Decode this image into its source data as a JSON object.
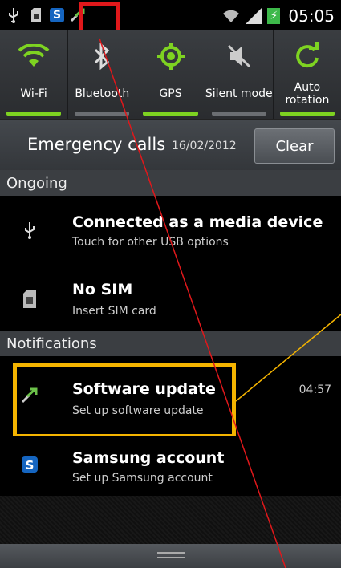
{
  "status_bar": {
    "time": "05:05",
    "icons": [
      "usb-icon",
      "sd-card-icon",
      "samsung-s-icon",
      "software-update-icon",
      "wifi-signal-icon",
      "cell-signal-icon",
      "battery-charging-icon"
    ],
    "samsung_letter": "S"
  },
  "toggles": [
    {
      "label": "Wi-Fi",
      "icon": "wifi-icon",
      "on": true
    },
    {
      "label": "Bluetooth",
      "icon": "bluetooth-icon",
      "on": false
    },
    {
      "label": "GPS",
      "icon": "gps-icon",
      "on": true
    },
    {
      "label": "Silent mode",
      "icon": "silent-mode-icon",
      "on": false
    },
    {
      "label": "Auto rotation",
      "icon": "rotation-icon",
      "on": true
    }
  ],
  "emergency": {
    "text": "Emergency calls",
    "date": "16/02/2012",
    "clear_label": "Clear"
  },
  "sections": {
    "ongoing": "Ongoing",
    "notifications": "Notifications"
  },
  "ongoing": [
    {
      "title": "Connected as a media device",
      "subtitle": "Touch for other USB options",
      "icon": "usb-icon"
    },
    {
      "title": "No SIM",
      "subtitle": "Insert SIM card",
      "icon": "sim-card-icon"
    }
  ],
  "notifications": [
    {
      "title": "Software update",
      "subtitle": "Set up software update",
      "time": "04:57",
      "icon": "software-update-icon"
    },
    {
      "title": "Samsung account",
      "subtitle": "Set up Samsung account",
      "icon": "samsung-account-icon"
    }
  ],
  "colors": {
    "toggle_on": "#7ed321",
    "highlight_red": "#e0181b",
    "highlight_yellow": "#f5b400",
    "samsung_blue": "#1565c0"
  }
}
